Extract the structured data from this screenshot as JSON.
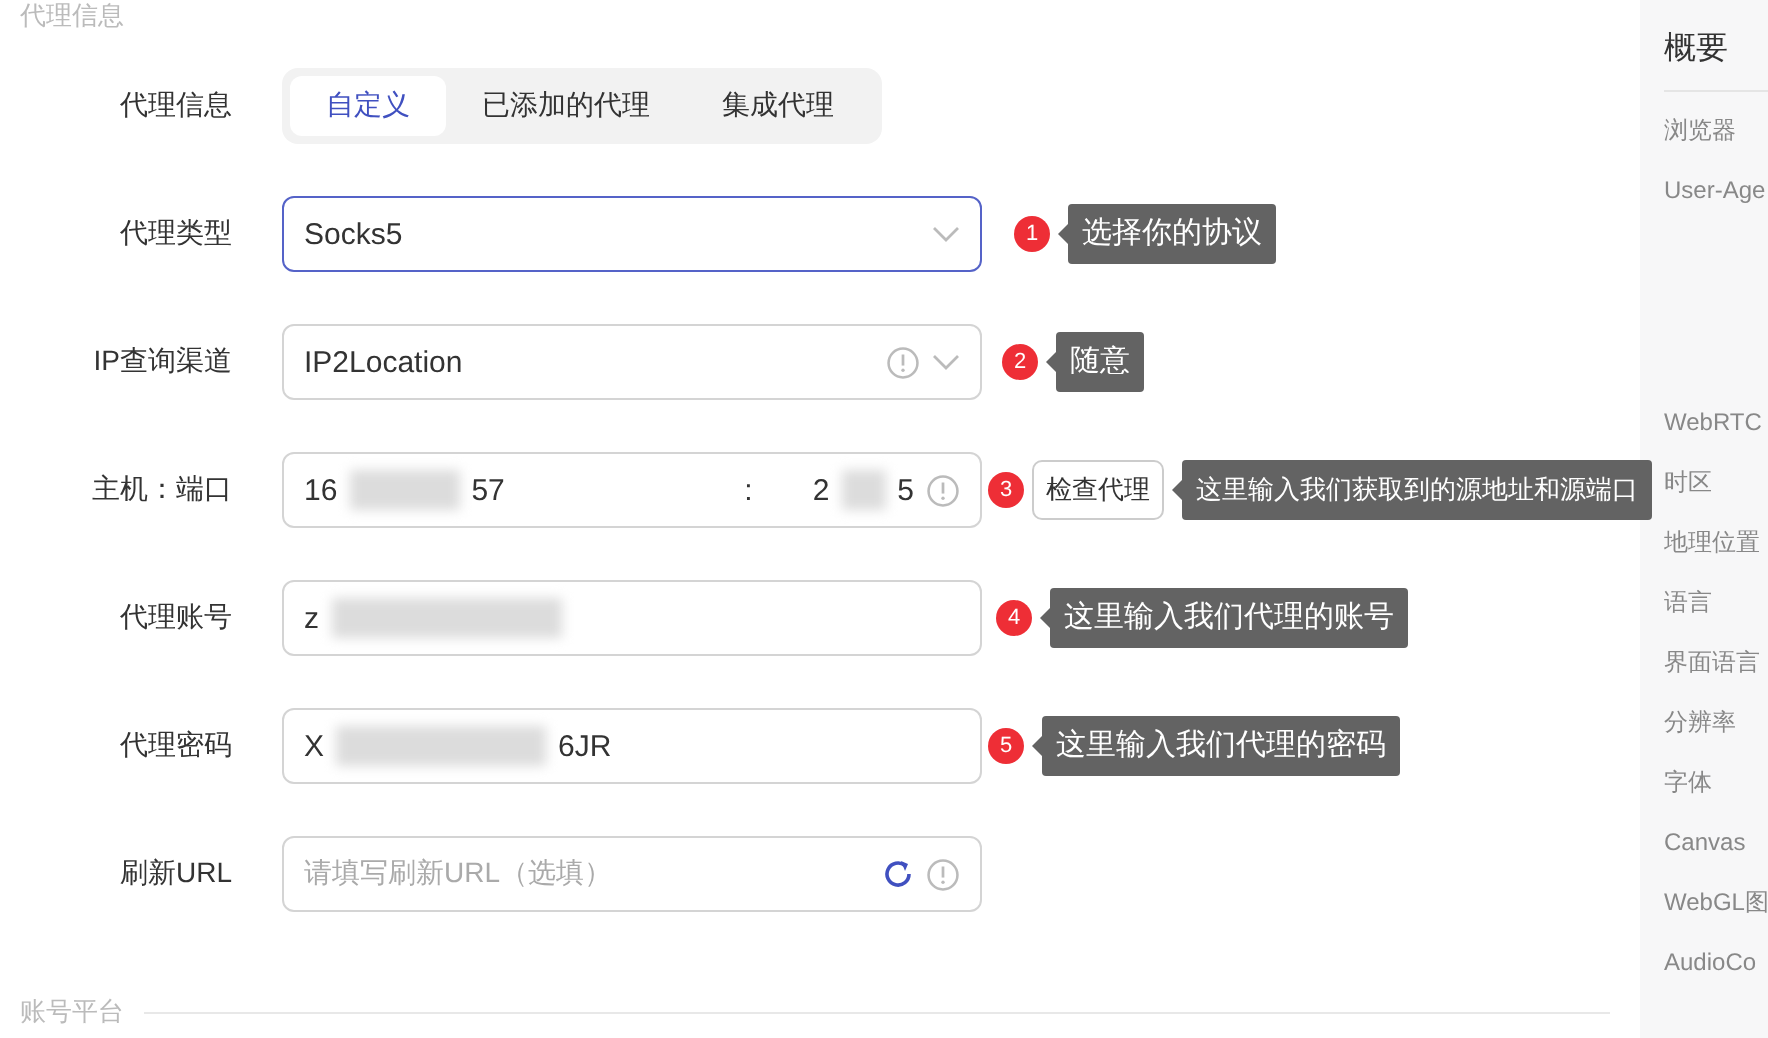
{
  "section_title": "代理信息",
  "rows": [
    {
      "kind": "tabs",
      "label": "代理信息",
      "tabs": [
        {
          "label": "自定义",
          "selected": true
        },
        {
          "label": "已添加的代理",
          "selected": false
        },
        {
          "label": "集成代理",
          "selected": false
        }
      ]
    },
    {
      "kind": "select",
      "label": "代理类型",
      "value": "Socks5",
      "focused": true,
      "info": false,
      "annotation": {
        "number": "1",
        "text": "选择你的协议"
      }
    },
    {
      "kind": "select",
      "label": "IP查询渠道",
      "value": "IP2Location",
      "focused": false,
      "info": true,
      "annotation": {
        "number": "2",
        "text": "随意"
      }
    },
    {
      "kind": "host_port",
      "label": "主机：端口",
      "host": [
        {
          "kind": "text",
          "text": "16"
        },
        {
          "kind": "blur"
        },
        {
          "kind": "text",
          "text": "57"
        }
      ],
      "separator": ":",
      "port": [
        {
          "kind": "text",
          "text": "2"
        },
        {
          "kind": "blur"
        },
        {
          "kind": "text",
          "text": "5"
        }
      ],
      "info": true,
      "button": "检查代理",
      "annotation": {
        "number": "3",
        "text": "这里输入我们获取到的源地址和源端口"
      }
    },
    {
      "kind": "text",
      "label": "代理账号",
      "value": [
        {
          "kind": "text",
          "text": "z"
        },
        {
          "kind": "blur"
        }
      ],
      "annotation": {
        "number": "4",
        "text": "这里输入我们代理的账号"
      }
    },
    {
      "kind": "text",
      "label": "代理密码",
      "value": [
        {
          "kind": "text",
          "text": "X"
        },
        {
          "kind": "blur"
        },
        {
          "kind": "text",
          "text": "6JR"
        }
      ],
      "annotation": {
        "number": "5",
        "text": "这里输入我们代理的密码"
      }
    },
    {
      "kind": "url",
      "label": "刷新URL",
      "placeholder": "请填写刷新URL（选填）",
      "info": true
    }
  ],
  "footer_section": "账号平台",
  "sidebar": {
    "title": "概要",
    "groups": [
      [
        "浏览器",
        "User-Age"
      ],
      [
        "WebRTC",
        "时区",
        "地理位置",
        "语言",
        "界面语言",
        "分辨率",
        "字体",
        "Canvas",
        "WebGL图",
        "AudioCo"
      ]
    ]
  }
}
